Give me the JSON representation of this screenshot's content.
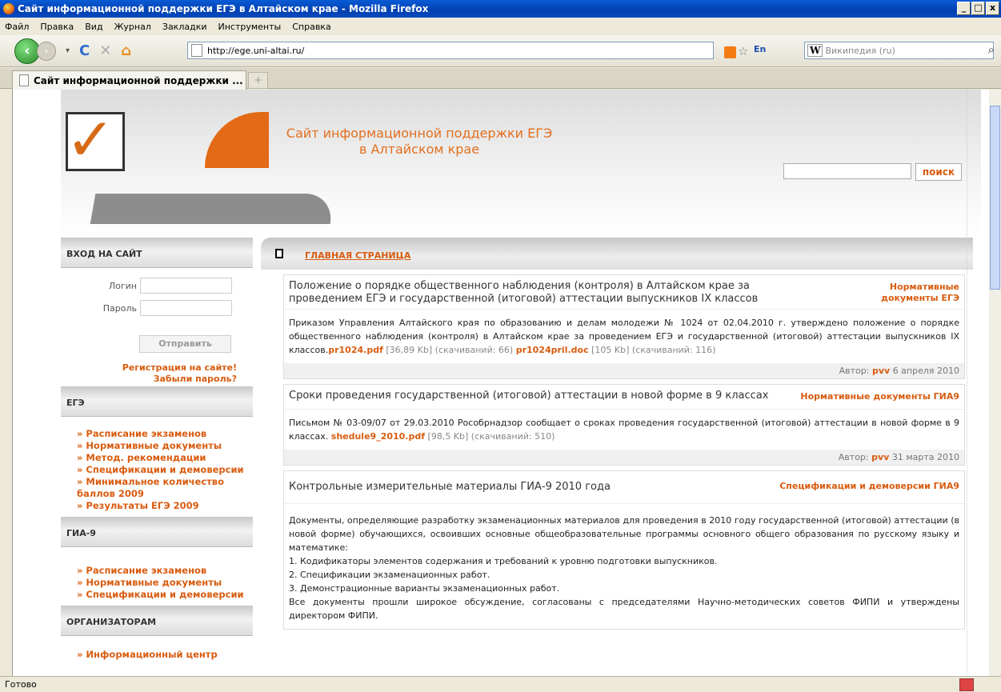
{
  "browser": {
    "window_title": "Сайт информационной поддержки ЕГЭ в Алтайском крае - Mozilla Firefox",
    "menu": [
      "Файл",
      "Правка",
      "Вид",
      "Журнал",
      "Закладки",
      "Инструменты",
      "Справка"
    ],
    "url": "http://ege.uni-altai.ru/",
    "lang_indicator": "En",
    "search_engine_placeholder": "Википедия (ru)",
    "tab_title": "Сайт информационной поддержки ...",
    "status_text": "Готово"
  },
  "site": {
    "header_title_line1": "Сайт информационной поддержки ЕГЭ",
    "header_title_line2": "в Алтайском крае",
    "search_button": "поиск"
  },
  "sidebar": {
    "login_heading": "ВХОД НА САЙТ",
    "login_label": "Логин",
    "password_label": "Пароль",
    "submit_button": "Отправить",
    "register_link": "Регистрация на сайте!",
    "forgot_link": "Забыли пароль?",
    "ege_heading": "ЕГЭ",
    "ege_items": [
      "» Расписание экзаменов",
      "» Нормативные документы",
      "» Метод. рекомендации",
      "» Спецификации и демоверсии",
      "» Минимальное количество баллов 2009",
      "» Результаты ЕГЭ 2009"
    ],
    "gia_heading": "ГИА-9",
    "gia_items": [
      "» Расписание экзаменов",
      "» Нормативные документы",
      "» Спецификации и демоверсии"
    ],
    "org_heading": "ОРГАНИЗАТОРАМ",
    "org_items": [
      "» Информационный центр"
    ]
  },
  "main": {
    "breadcrumb": "ГЛАВНАЯ СТРАНИЦА",
    "articles": [
      {
        "title": "Положение о порядке общественного наблюдения (контроля) в Алтайском крае за проведением ЕГЭ и государственной (итоговой) аттестации выпускников IX классов",
        "category": "Нормативные документы ЕГЭ",
        "body": "Приказом Управления Алтайского края по образованию и делам молодежи № 1024 от 02.04.2010 г. утверждено положение о порядке общественного наблюдения (контроля) в Алтайском крае за проведением ЕГЭ и государственной (итоговой) аттестации выпускников IX классов.",
        "file1": "pr1024.pdf",
        "file1_meta": " [36,89 Kb] (скачиваний: 66) ",
        "file2": "pr1024pril.doc",
        "file2_meta": " [105 Kb] (скачиваний: 116)",
        "author_label": "Автор: ",
        "author": "pvv",
        "date": " 6 апреля 2010"
      },
      {
        "title": "Сроки проведения государственной (итоговой) аттестации в новой форме в 9 классах",
        "category": "Нормативные документы ГИА9",
        "body": "Письмом № 03-09/07 от 29.03.2010 Рособрнадзор сообщает о сроках проведения государственной (итоговой) аттестации в новой форме в 9 классах. ",
        "file1": "shedule9_2010.pdf",
        "file1_meta": " [98,5 Kb] (скачиваний: 510)",
        "author_label": "Автор: ",
        "author": "pvv",
        "date": " 31 марта 2010"
      },
      {
        "title": "Контрольные измерительные материалы ГИА-9 2010 года",
        "category": "Спецификации и демоверсии ГИА9",
        "body_lines": [
          "Документы, определяющие разработку экзаменационных материалов для проведения в 2010 году государственной (итоговой) аттестации (в новой форме) обучающихся, освоивших основные общеобразовательные программы основного общего образования по русскому языку и математике:",
          "1. Кодификаторы элементов содержания и требований к уровню подготовки выпускников.",
          "2. Спецификации экзаменационных работ.",
          "3. Демонстрационные варианты экзаменационных работ.",
          "Все документы прошли широкое обсуждение, согласованы с председателями Научно-методических советов ФИПИ и утверждены директором ФИПИ."
        ]
      }
    ]
  }
}
